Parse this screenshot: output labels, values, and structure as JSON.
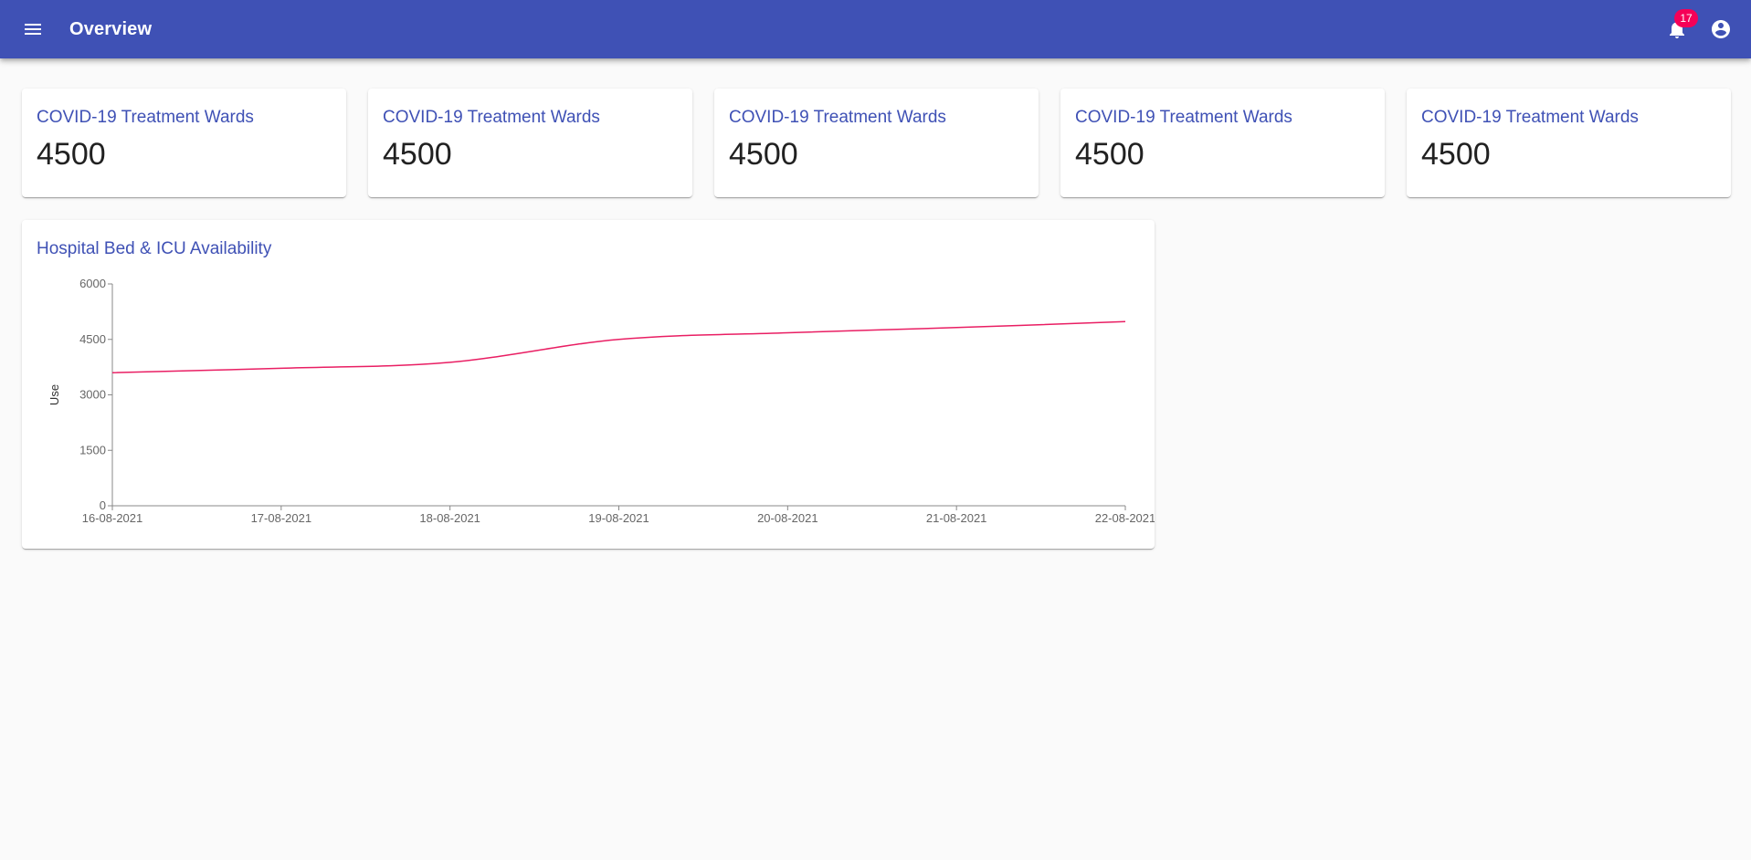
{
  "app": {
    "title": "Overview",
    "notification_count": "17",
    "colors": {
      "primary": "#3f51b5",
      "badge": "#f50057",
      "line": "#e91e63"
    },
    "icons": {
      "menu": "menu-icon",
      "notifications": "bell-icon",
      "account": "account-circle-icon"
    }
  },
  "stats": [
    {
      "label": "COVID-19 Treatment Wards",
      "value": "4500"
    },
    {
      "label": "COVID-19 Treatment Wards",
      "value": "4500"
    },
    {
      "label": "COVID-19 Treatment Wards",
      "value": "4500"
    },
    {
      "label": "COVID-19 Treatment Wards",
      "value": "4500"
    },
    {
      "label": "COVID-19 Treatment Wards",
      "value": "4500"
    }
  ],
  "chart_data": {
    "type": "line",
    "title": "Hospital Bed & ICU Availability",
    "xlabel": "",
    "ylabel": "Use",
    "x": [
      "16-08-2021",
      "17-08-2021",
      "18-08-2021",
      "19-08-2021",
      "20-08-2021",
      "21-08-2021",
      "22-08-2021"
    ],
    "yticks": [
      "0",
      "1500",
      "3000",
      "4500",
      "6000"
    ],
    "ylim": [
      0,
      6000
    ],
    "grid": false,
    "series": [
      {
        "values": [
          3600,
          3720,
          3880,
          4500,
          4680,
          4820,
          4980
        ]
      }
    ]
  }
}
